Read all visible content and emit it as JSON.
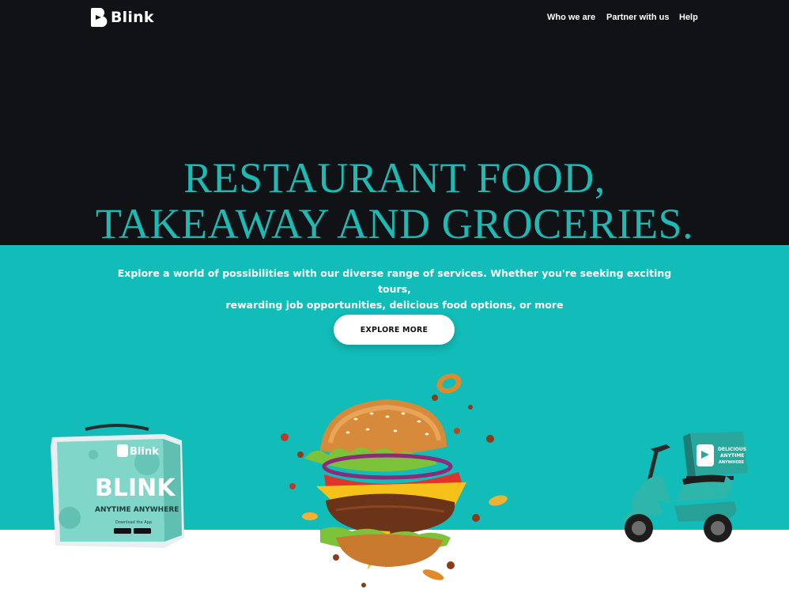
{
  "brand": {
    "name": "Blink"
  },
  "nav": {
    "items": [
      {
        "label": "Who we are"
      },
      {
        "label": "Partner with us"
      },
      {
        "label": "Help"
      }
    ]
  },
  "hero": {
    "headline_line1": "RESTAURANT FOOD,",
    "headline_line2": "TAKEAWAY AND GROCERIES.",
    "tagline_line1": "Explore a world of possibilities with our diverse range of services. Whether you're seeking exciting tours,",
    "tagline_line2": "rewarding job opportunities, delicious food options, or more",
    "cta_label": "EXPLORE MORE"
  },
  "bag": {
    "brand_label": "Blink",
    "big_label": "BLINK",
    "sub_label": "ANYTIME ANYWHERE",
    "download_label": "Download the App"
  },
  "scooter": {
    "box_line1": "DELICIOUS",
    "box_line2": "ANYTIME",
    "box_line3": "ANYWHERE"
  },
  "colors": {
    "dark_bg": "#111216",
    "teal": "#12bcb8",
    "headline": "#1fb9b4",
    "white": "#ffffff"
  },
  "icons": [
    "blink-logo-icon",
    "burger-illustration",
    "delivery-bag-illustration",
    "scooter-illustration"
  ]
}
